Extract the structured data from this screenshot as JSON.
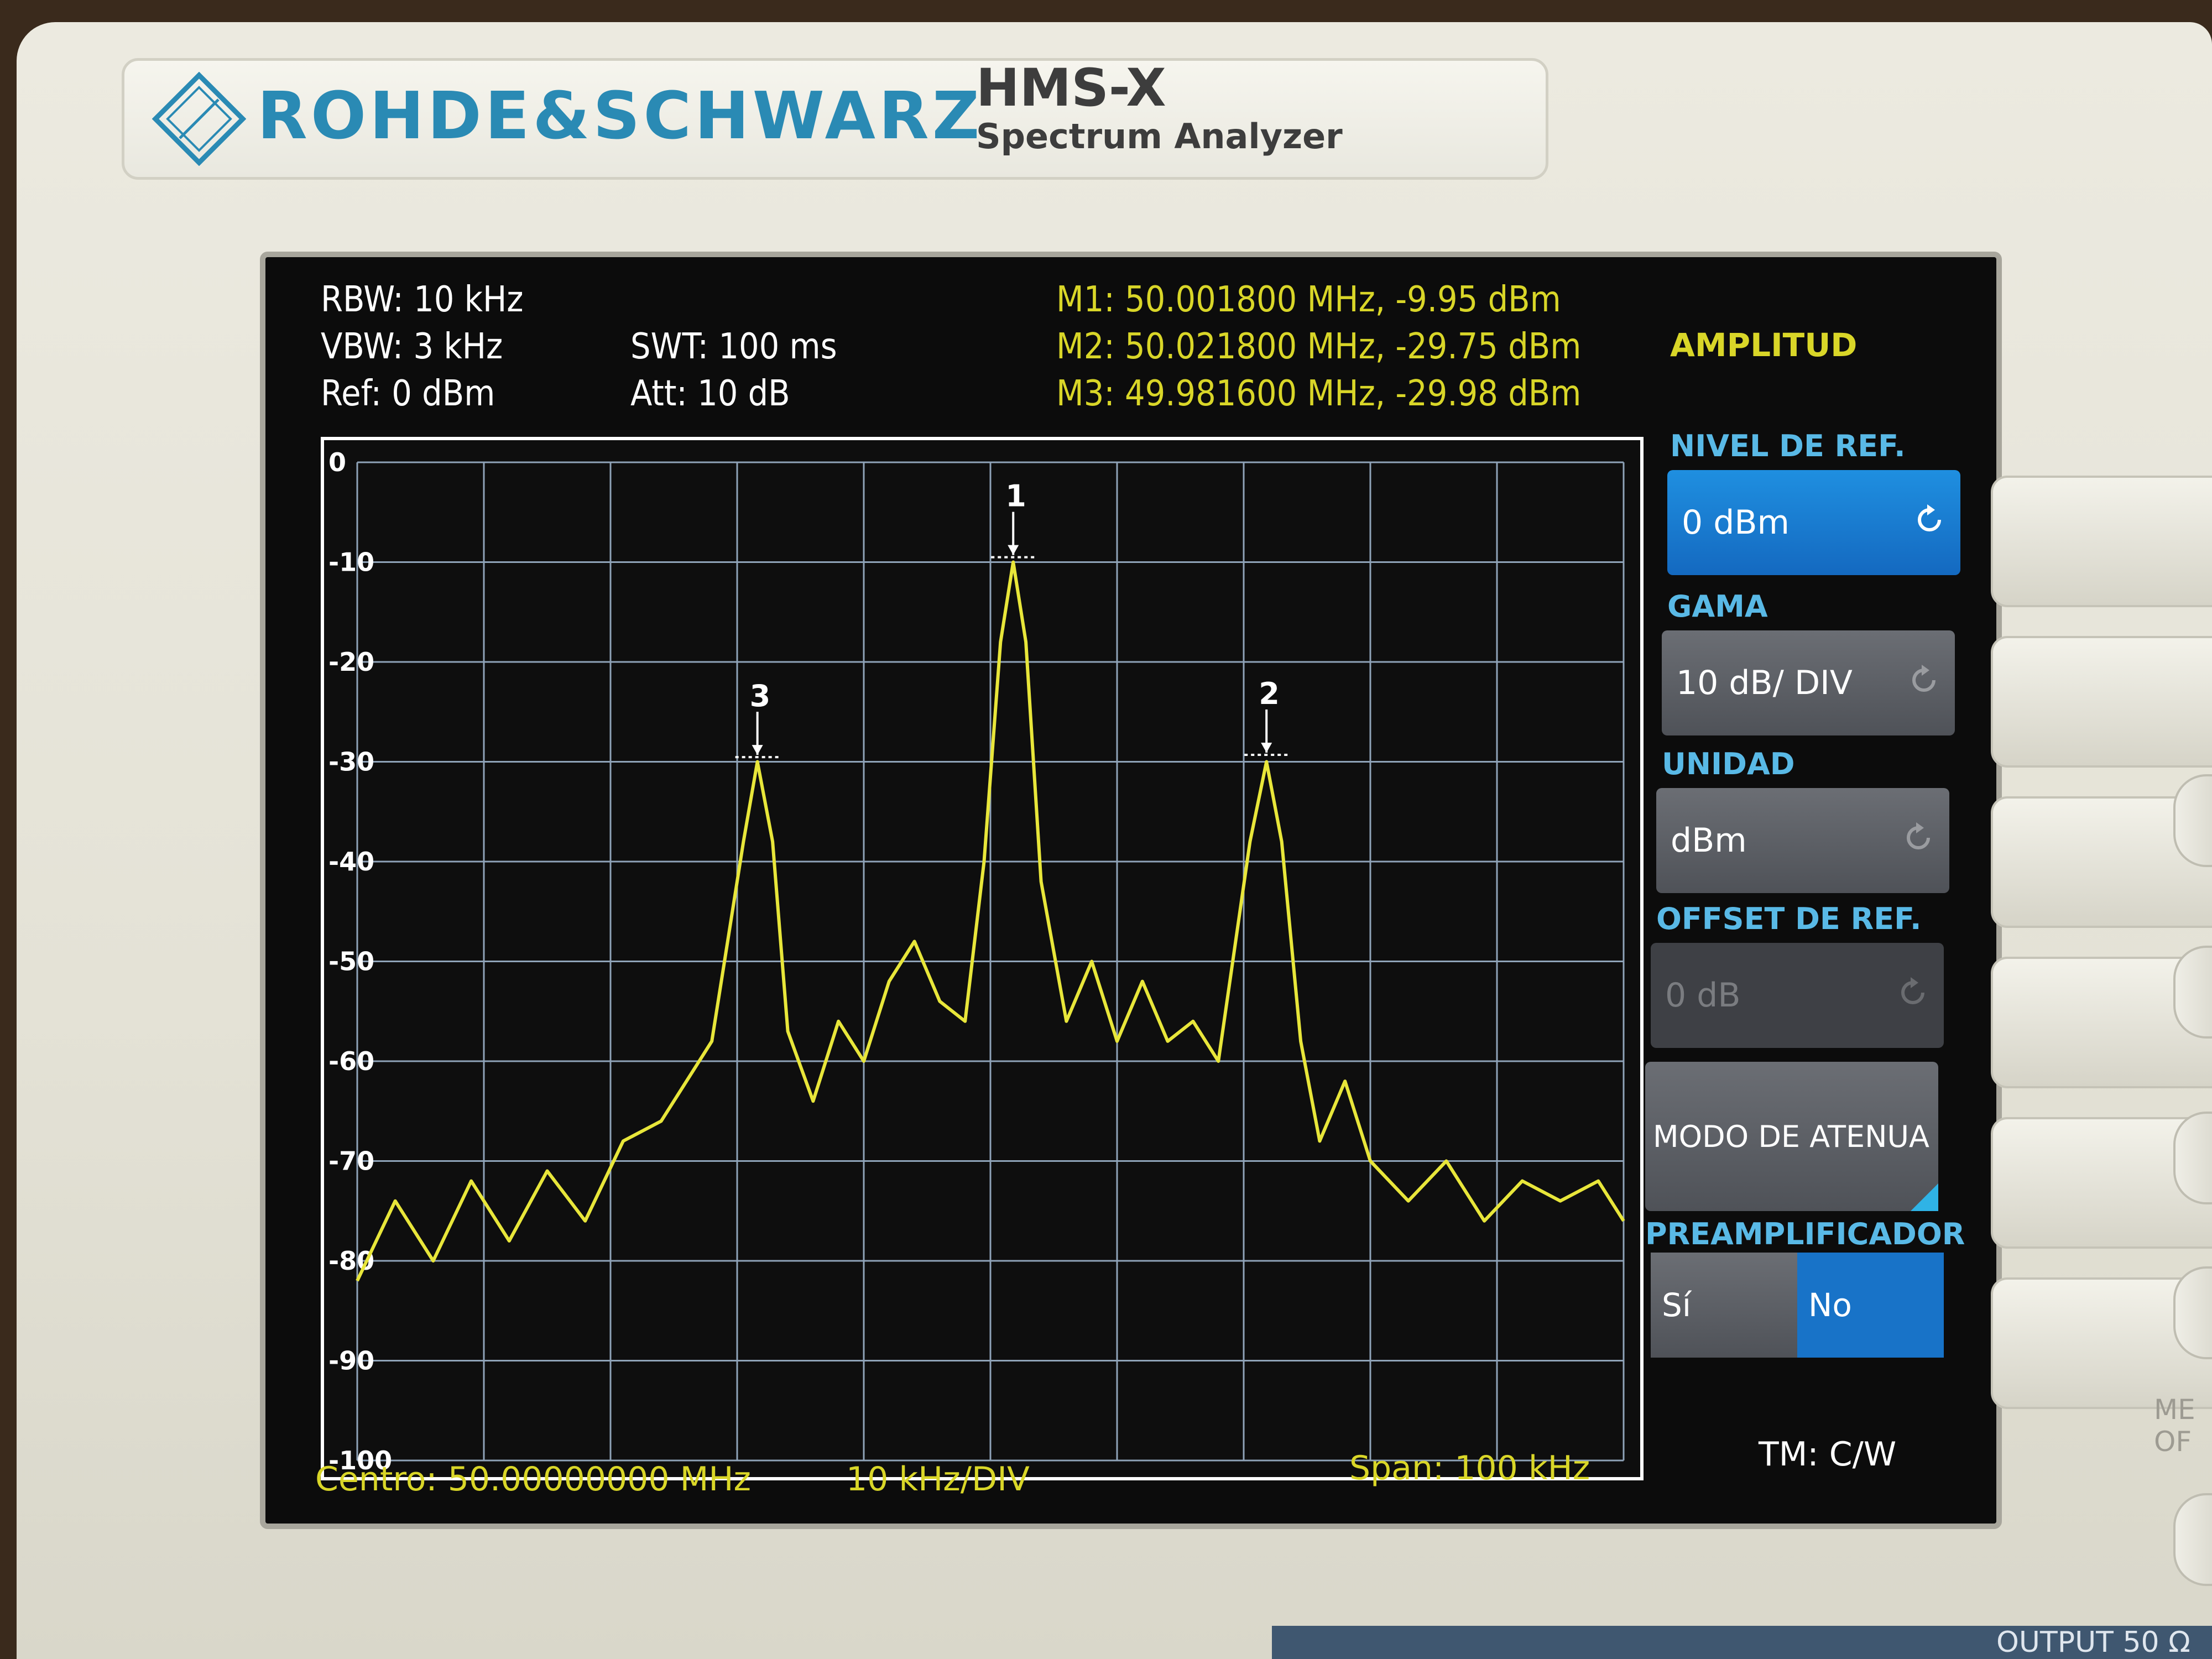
{
  "device": {
    "brand": "ROHDE&SCHWARZ",
    "model": "HMS-X",
    "model_subtitle": "Spectrum Analyzer",
    "logo_monogram": "R&S",
    "output_label": "OUTPUT 50 Ω",
    "mem_label": "ME\nOF"
  },
  "settings": {
    "rbw": "RBW: 10 kHz",
    "vbw": "VBW: 3 kHz",
    "ref": "Ref: 0 dBm",
    "swt": "SWT: 100 ms",
    "att": "Att: 10 dB"
  },
  "markers": [
    {
      "label": "M1: 50.001800 MHz, -9.95 dBm",
      "id": "1",
      "freq_mhz": 50.0018,
      "level_dbm": -9.95
    },
    {
      "label": "M2: 50.021800 MHz, -29.75 dBm",
      "id": "2",
      "freq_mhz": 50.0218,
      "level_dbm": -29.75
    },
    {
      "label": "M3: 49.981600 MHz, -29.98 dBm",
      "id": "3",
      "freq_mhz": 49.9816,
      "level_dbm": -29.98
    }
  ],
  "footer": {
    "center": "Centro: 50.00000000 MHz",
    "div": "10 kHz/DIV",
    "span": "Span: 100 kHz",
    "mode": "TM: C/W"
  },
  "menu": {
    "title": "AMPLITUD",
    "ref_level_head": "NIVEL DE REF.",
    "ref_level_value": "0 dBm",
    "range_head": "GAMA",
    "range_value": "10 dB/ DIV",
    "unit_head": "UNIDAD",
    "unit_value": "dBm",
    "offset_head": "OFFSET DE REF.",
    "offset_value": "0 dB",
    "atten_label": "MODO DE ATENUA",
    "preamp_head": "PREAMPLIFICADOR",
    "preamp_yes": "Sí",
    "preamp_no": "No"
  },
  "colors": {
    "trace": "#e8e63a",
    "grid": "#8fa3b8",
    "accent_blue": "#1f8fe0",
    "brand_blue": "#2a8ab4"
  },
  "chart_data": {
    "type": "line",
    "x_unit": "MHz",
    "y_unit": "dBm",
    "xlim": [
      49.95,
      50.05
    ],
    "ylim": [
      -100,
      0
    ],
    "y_ticks": [
      "0",
      "-10",
      "-20",
      "-30",
      "-40",
      "-50",
      "-60",
      "-70",
      "-80",
      "-90",
      "-100"
    ],
    "grid": true,
    "series": [
      {
        "values": [
          [
            49.95,
            -82
          ],
          [
            49.953,
            -74
          ],
          [
            49.956,
            -80
          ],
          [
            49.959,
            -72
          ],
          [
            49.962,
            -78
          ],
          [
            49.965,
            -71
          ],
          [
            49.968,
            -76
          ],
          [
            49.971,
            -68
          ],
          [
            49.974,
            -66
          ],
          [
            49.976,
            -62
          ],
          [
            49.978,
            -58
          ],
          [
            49.979,
            -50
          ],
          [
            49.9805,
            -38
          ],
          [
            49.9816,
            -30
          ],
          [
            49.9828,
            -38
          ],
          [
            49.984,
            -57
          ],
          [
            49.986,
            -64
          ],
          [
            49.988,
            -56
          ],
          [
            49.99,
            -60
          ],
          [
            49.992,
            -52
          ],
          [
            49.994,
            -48
          ],
          [
            49.996,
            -54
          ],
          [
            49.998,
            -56
          ],
          [
            49.9995,
            -40
          ],
          [
            50.0008,
            -18
          ],
          [
            50.0018,
            -10
          ],
          [
            50.0028,
            -18
          ],
          [
            50.004,
            -42
          ],
          [
            50.006,
            -56
          ],
          [
            50.008,
            -50
          ],
          [
            50.01,
            -58
          ],
          [
            50.012,
            -52
          ],
          [
            50.014,
            -58
          ],
          [
            50.016,
            -56
          ],
          [
            50.018,
            -60
          ],
          [
            50.0205,
            -38
          ],
          [
            50.0218,
            -30
          ],
          [
            50.023,
            -38
          ],
          [
            50.0245,
            -58
          ],
          [
            50.026,
            -68
          ],
          [
            50.028,
            -62
          ],
          [
            50.03,
            -70
          ],
          [
            50.033,
            -74
          ],
          [
            50.036,
            -70
          ],
          [
            50.039,
            -76
          ],
          [
            50.042,
            -72
          ],
          [
            50.045,
            -74
          ],
          [
            50.048,
            -72
          ],
          [
            50.05,
            -76
          ]
        ]
      }
    ]
  }
}
